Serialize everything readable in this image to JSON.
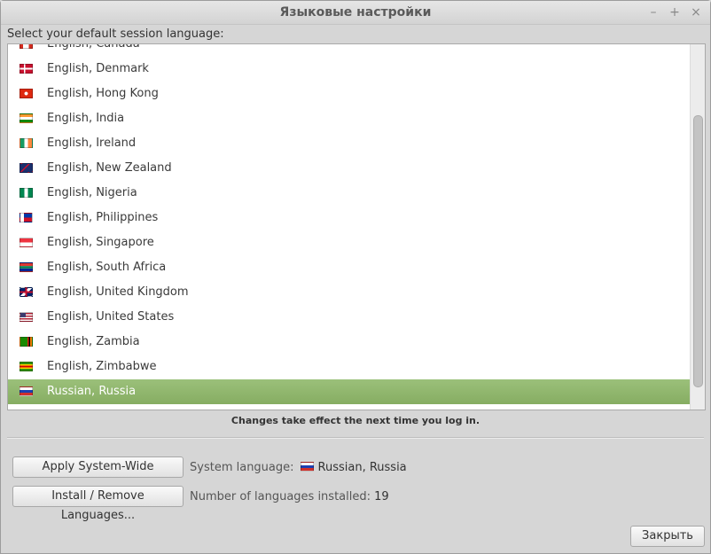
{
  "window": {
    "title": "Языковые настройки",
    "controls": {
      "minimize": "–",
      "maximize": "+",
      "close": "×"
    }
  },
  "prompt": "Select your default session language:",
  "languages": [
    {
      "label": "English, Canada",
      "flag": "canada-flag-icon"
    },
    {
      "label": "English, Denmark",
      "flag": "denmark-flag-icon"
    },
    {
      "label": "English, Hong Kong",
      "flag": "hong-kong-flag-icon"
    },
    {
      "label": "English, India",
      "flag": "india-flag-icon"
    },
    {
      "label": "English, Ireland",
      "flag": "ireland-flag-icon"
    },
    {
      "label": "English, New Zealand",
      "flag": "new-zealand-flag-icon"
    },
    {
      "label": "English, Nigeria",
      "flag": "nigeria-flag-icon"
    },
    {
      "label": "English, Philippines",
      "flag": "philippines-flag-icon"
    },
    {
      "label": "English, Singapore",
      "flag": "singapore-flag-icon"
    },
    {
      "label": "English, South Africa",
      "flag": "south-africa-flag-icon"
    },
    {
      "label": "English, United Kingdom",
      "flag": "united-kingdom-flag-icon"
    },
    {
      "label": "English, United States",
      "flag": "united-states-flag-icon"
    },
    {
      "label": "English, Zambia",
      "flag": "zambia-flag-icon"
    },
    {
      "label": "English, Zimbabwe",
      "flag": "zimbabwe-flag-icon"
    },
    {
      "label": "Russian, Russia",
      "flag": "russia-flag-icon",
      "selected": true
    }
  ],
  "notice": "Changes take effect the next time you log in.",
  "buttons": {
    "apply": "Apply System-Wide",
    "install": "Install / Remove Languages...",
    "close": "Закрыть"
  },
  "system_language": {
    "label": "System language:",
    "value": "Russian, Russia"
  },
  "installed": {
    "label": "Number of languages installed:",
    "count": "19"
  },
  "colors": {
    "selection": "#8db66a",
    "window_bg": "#d6d6d6"
  }
}
